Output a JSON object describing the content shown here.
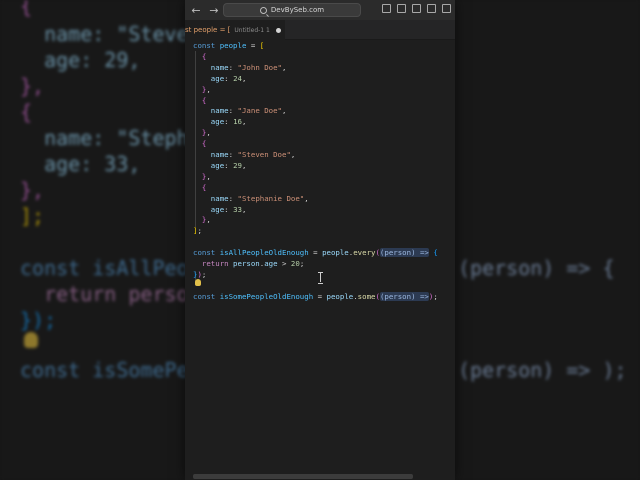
{
  "browser": {
    "back_glyph": "←",
    "forward_glyph": "→",
    "address": "DevBySeb.com",
    "icons": [
      "sidebar-icon",
      "layout-icon",
      "grid-icon",
      "split-icon",
      "panel-icon"
    ]
  },
  "editor": {
    "tab": {
      "title": "st people = [",
      "subtitle": "Untitled-1 1",
      "modified": true
    }
  },
  "background": {
    "lines": [
      "{",
      "  name: \"Steve",
      "  age: 29,",
      "},",
      "{",
      "  name: \"Steph",
      "  age: 33,",
      "},",
      "];",
      "const isAllPeopl",
      "  return person.",
      "});",
      "const isSomePeop"
    ],
    "right_fragments": [
      "(person) => {",
      "(person) => );"
    ]
  },
  "code": [
    [
      [
        "kw",
        "const "
      ],
      [
        "var",
        "people"
      ],
      [
        "punc",
        " = "
      ],
      [
        "b1",
        "["
      ]
    ],
    [
      [
        "b2",
        "  {"
      ]
    ],
    [
      [
        "prop",
        "    name"
      ],
      [
        "punc",
        ": "
      ],
      [
        "str",
        "\"John Doe\""
      ],
      [
        "punc",
        ","
      ]
    ],
    [
      [
        "prop",
        "    age"
      ],
      [
        "punc",
        ": "
      ],
      [
        "num",
        "24"
      ],
      [
        "punc",
        ","
      ]
    ],
    [
      [
        "b2",
        "  }"
      ],
      [
        "punc",
        ","
      ]
    ],
    [
      [
        "b2",
        "  {"
      ]
    ],
    [
      [
        "prop",
        "    name"
      ],
      [
        "punc",
        ": "
      ],
      [
        "str",
        "\"Jane Doe\""
      ],
      [
        "punc",
        ","
      ]
    ],
    [
      [
        "prop",
        "    age"
      ],
      [
        "punc",
        ": "
      ],
      [
        "num",
        "16"
      ],
      [
        "punc",
        ","
      ]
    ],
    [
      [
        "b2",
        "  }"
      ],
      [
        "punc",
        ","
      ]
    ],
    [
      [
        "b2",
        "  {"
      ]
    ],
    [
      [
        "prop",
        "    name"
      ],
      [
        "punc",
        ": "
      ],
      [
        "str",
        "\"Steven Doe\""
      ],
      [
        "punc",
        ","
      ]
    ],
    [
      [
        "prop",
        "    age"
      ],
      [
        "punc",
        ": "
      ],
      [
        "num",
        "29"
      ],
      [
        "punc",
        ","
      ]
    ],
    [
      [
        "b2",
        "  }"
      ],
      [
        "punc",
        ","
      ]
    ],
    [
      [
        "b2",
        "  {"
      ]
    ],
    [
      [
        "prop",
        "    name"
      ],
      [
        "punc",
        ": "
      ],
      [
        "str",
        "\"Stephanie Doe\""
      ],
      [
        "punc",
        ","
      ]
    ],
    [
      [
        "prop",
        "    age"
      ],
      [
        "punc",
        ": "
      ],
      [
        "num",
        "33"
      ],
      [
        "punc",
        ","
      ]
    ],
    [
      [
        "b2",
        "  }"
      ],
      [
        "punc",
        ","
      ]
    ],
    [
      [
        "b1",
        "]"
      ],
      [
        "punc",
        ";"
      ]
    ],
    [],
    [
      [
        "kw",
        "const "
      ],
      [
        "var",
        "isAllPeopleOldEnough"
      ],
      [
        "punc",
        " = "
      ],
      [
        "prop",
        "people"
      ],
      [
        "punc",
        "."
      ],
      [
        "fn",
        "every"
      ],
      [
        "b2",
        "("
      ],
      [
        "hint",
        "(person) =>"
      ],
      [
        "punc",
        " "
      ],
      [
        "b3",
        "{"
      ]
    ],
    [
      [
        "ctl",
        "  return "
      ],
      [
        "prop",
        "person"
      ],
      [
        "punc",
        "."
      ],
      [
        "prop",
        "age"
      ],
      [
        "punc",
        " > "
      ],
      [
        "num",
        "20"
      ],
      [
        "punc",
        ";"
      ]
    ],
    [
      [
        "b3",
        "}"
      ],
      [
        "b2",
        ")"
      ],
      [
        "punc",
        ";"
      ]
    ],
    [],
    [
      [
        "kw",
        "const "
      ],
      [
        "var",
        "isSomePeopleOldEnough"
      ],
      [
        "punc",
        " = "
      ],
      [
        "prop",
        "people"
      ],
      [
        "punc",
        "."
      ],
      [
        "fn",
        "some"
      ],
      [
        "b2",
        "("
      ],
      [
        "hint",
        "(person) =>"
      ],
      [
        "b2",
        ")"
      ],
      [
        "punc",
        ";"
      ]
    ]
  ]
}
